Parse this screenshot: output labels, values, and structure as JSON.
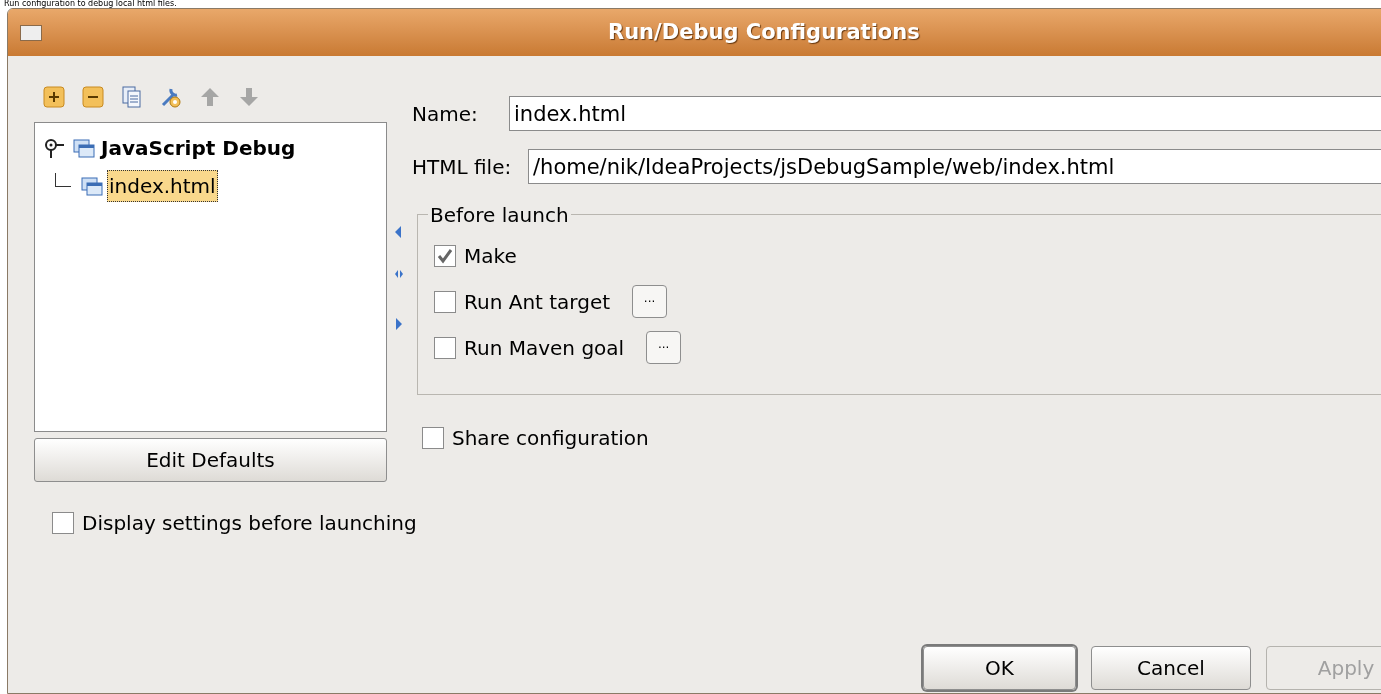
{
  "caption": "Run configuration to debug local html files.",
  "window": {
    "title": "Run/Debug Configurations"
  },
  "toolbar": [
    {
      "kind": "add",
      "disabled": false
    },
    {
      "kind": "remove",
      "disabled": false
    },
    {
      "kind": "copy",
      "disabled": false
    },
    {
      "kind": "defaults",
      "disabled": false
    },
    {
      "kind": "up",
      "disabled": true
    },
    {
      "kind": "down",
      "disabled": true
    }
  ],
  "tree": [
    {
      "label": "JavaScript Debug",
      "selected": false,
      "children": [
        {
          "label": "index.html",
          "selected": true
        }
      ]
    }
  ],
  "edit_defaults": "Edit Defaults",
  "display_settings": {
    "label": "Display settings before launching",
    "checked": false
  },
  "name": {
    "label": "Name:",
    "value": "index.html"
  },
  "html_file": {
    "label": "HTML file:",
    "value": "/home/nik/IdeaProjects/jsDebugSample/web/index.html"
  },
  "before_launch": {
    "title": "Before launch",
    "items": [
      {
        "label": "Make",
        "checked": true,
        "has_browse": false
      },
      {
        "label": "Run Ant target",
        "checked": false,
        "has_browse": true
      },
      {
        "label": "Run Maven goal",
        "checked": false,
        "has_browse": true
      }
    ]
  },
  "browse_label": "···",
  "share": {
    "label": "Share configuration",
    "checked": false
  },
  "buttons": [
    {
      "label": "OK",
      "default": true,
      "disabled": false
    },
    {
      "label": "Cancel",
      "default": false,
      "disabled": false
    },
    {
      "label": "Apply",
      "default": false,
      "disabled": true
    }
  ]
}
